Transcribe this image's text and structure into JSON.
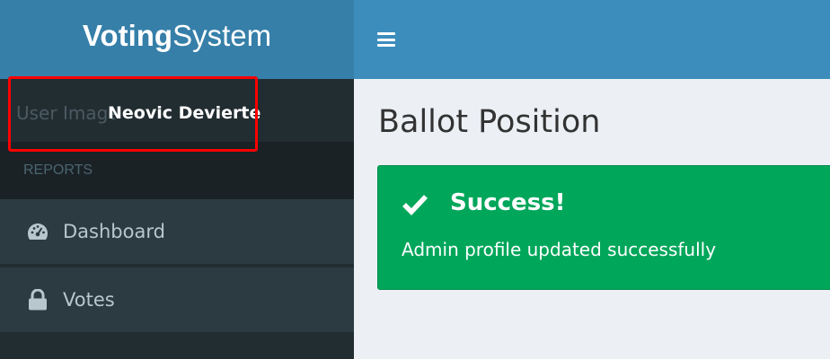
{
  "brand": {
    "bold": "Voting",
    "light": "System"
  },
  "user": {
    "image_alt": "User Image",
    "name": "Neovic Devierte"
  },
  "sidebar": {
    "section_header": "REPORTS",
    "items": [
      {
        "label": "Dashboard",
        "icon": "dashboard-icon"
      },
      {
        "label": "Votes",
        "icon": "lock-icon"
      }
    ]
  },
  "navbar": {
    "toggle_icon": "hamburger-menu-icon"
  },
  "main": {
    "title": "Ballot Position",
    "alert": {
      "title": "Success!",
      "message": "Admin profile updated successfully",
      "icon": "check-icon"
    }
  },
  "colors": {
    "logo_bg": "#367fa9",
    "navbar_bg": "#3c8dbc",
    "sidebar_bg": "#222d32",
    "success": "#00a65a",
    "highlight": "#ff0000"
  }
}
